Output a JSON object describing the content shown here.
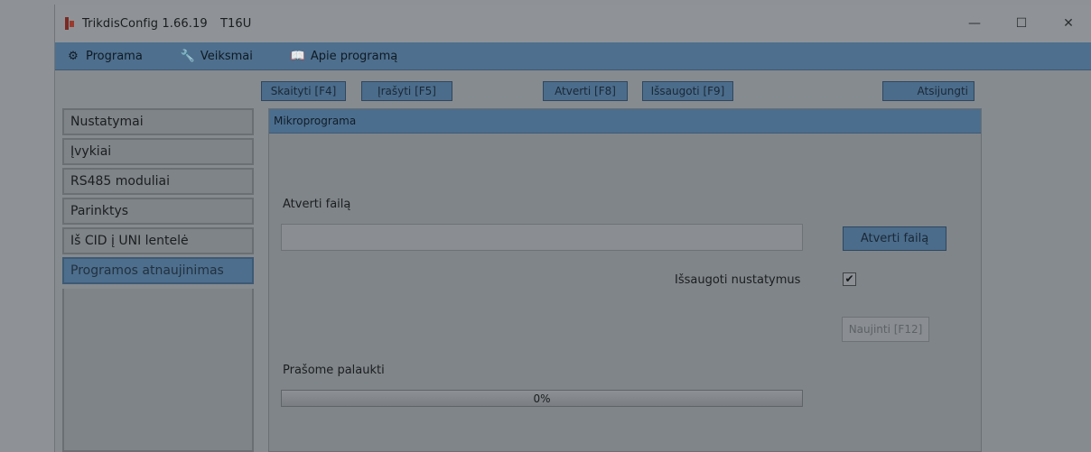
{
  "window": {
    "app_name": "TrikdisConfig 1.66.19",
    "device": "T16U",
    "controls": {
      "minimize": "—",
      "maximize": "☐",
      "close": "✕"
    }
  },
  "menu": [
    {
      "label": "Programa",
      "icon": "gear-icon"
    },
    {
      "label": "Veiksmai",
      "icon": "wrench-icon"
    },
    {
      "label": "Apie programą",
      "icon": "book-icon"
    }
  ],
  "toolbar": {
    "read": "Skaityti [F4]",
    "write": "Įrašyti [F5]",
    "open": "Atverti [F8]",
    "save": "Išsaugoti [F9]",
    "disconnect": "Atsijungti"
  },
  "sidebar": {
    "items": [
      {
        "label": "Nustatymai"
      },
      {
        "label": "Įvykiai"
      },
      {
        "label": "RS485 moduliai"
      },
      {
        "label": "Parinktys"
      },
      {
        "label": "Iš CID į UNI lentelė"
      },
      {
        "label": "Programos atnaujinimas"
      }
    ],
    "active_index": 5
  },
  "panel": {
    "title": "Mikroprograma",
    "open_file_label": "Atverti failą",
    "file_path": "",
    "open_file_button": "Atverti failą",
    "save_settings_label": "Išsaugoti nustatymus",
    "save_settings_checked": true,
    "update_button": "Naujinti [F12]",
    "wait_label": "Prašome palaukti",
    "progress": {
      "value": 0,
      "text": "0%"
    }
  },
  "colors": {
    "accent": "#4c6e8e",
    "menubar": "#4e6f8d",
    "background": "#868b8f"
  }
}
